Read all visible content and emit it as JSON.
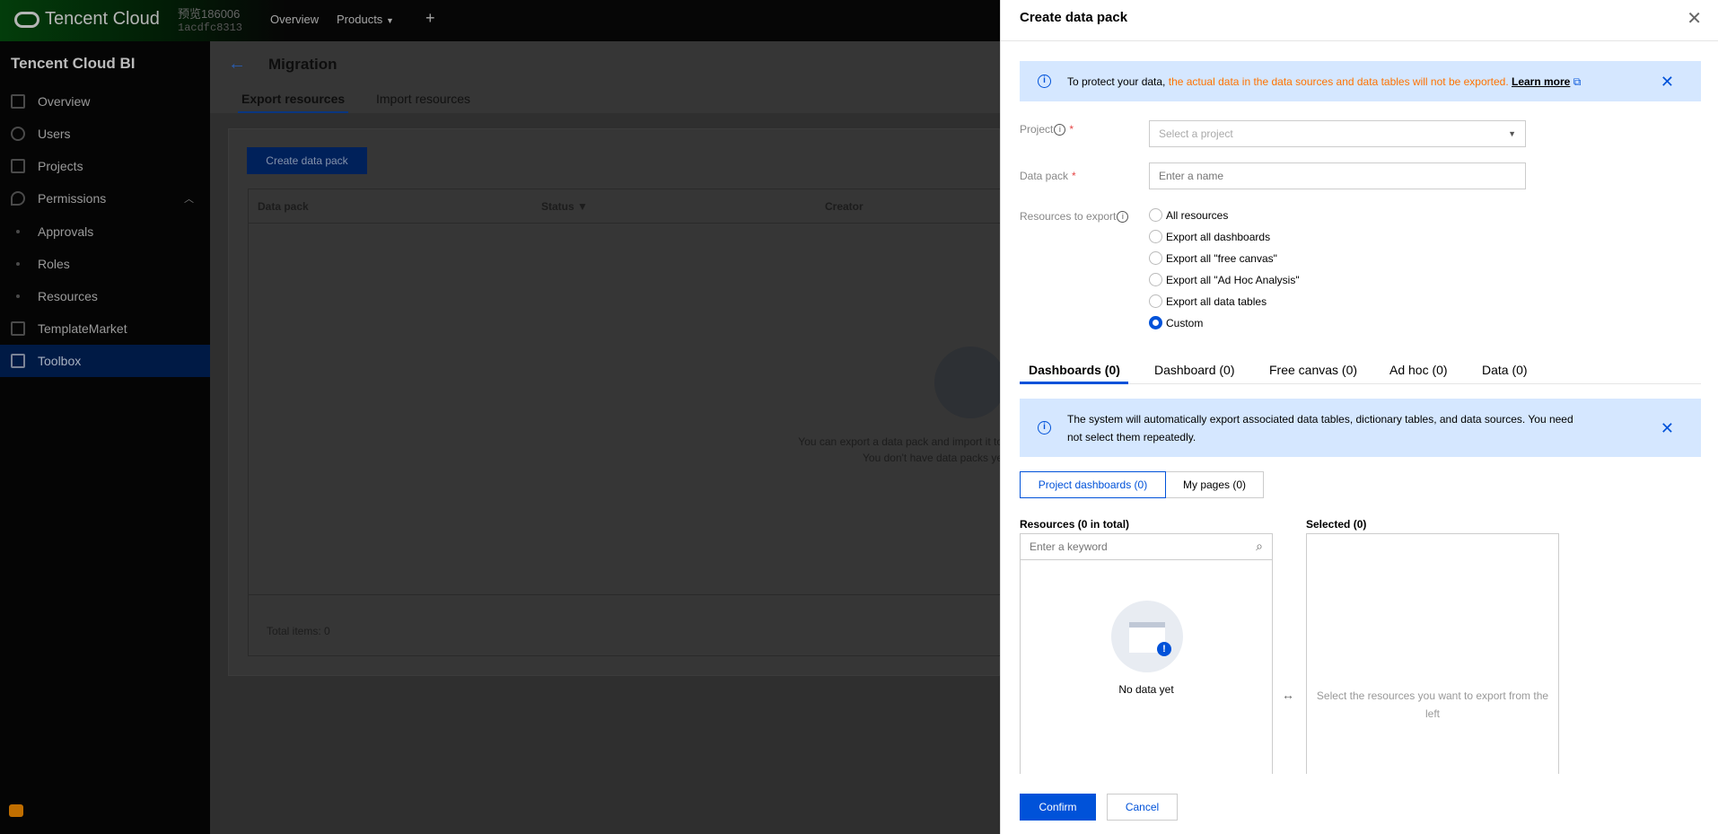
{
  "topbar": {
    "brand": "Tencent Cloud",
    "account_name": "预览186006",
    "account_id": "1acdfc8313",
    "nav": [
      "Overview",
      "Products"
    ],
    "plus": "+"
  },
  "sidebar": {
    "title": "Tencent Cloud BI",
    "items": [
      {
        "label": "Overview",
        "icon": "grid-icon"
      },
      {
        "label": "Users",
        "icon": "user-icon"
      },
      {
        "label": "Projects",
        "icon": "project-icon"
      },
      {
        "label": "Permissions",
        "icon": "key-icon"
      },
      {
        "label": "Approvals"
      },
      {
        "label": "Roles"
      },
      {
        "label": "Resources"
      },
      {
        "label": "TemplateMarket",
        "icon": "template-icon"
      },
      {
        "label": "Toolbox",
        "icon": "toolbox-icon",
        "active": true
      }
    ]
  },
  "main": {
    "title": "Migration",
    "tabs": [
      "Export resources",
      "Import resources"
    ],
    "create_button": "Create data pack",
    "columns": [
      "Data pack",
      "Status",
      "Creator"
    ],
    "empty_line1": "You can export a data pack and import it to",
    "empty_line2": "You don't have data packs ye",
    "total": "Total items:  0"
  },
  "drawer": {
    "title": "Create data pack",
    "alert1": {
      "prefix": "To protect your data, ",
      "highlight": "the actual data in the data sources and data tables will not be exported.",
      "link": "Learn more"
    },
    "project_label": "Project",
    "project_placeholder": "Select a project",
    "datapack_label": "Data pack",
    "datapack_placeholder": "Enter a name",
    "resources_label": "Resources to export",
    "radios": [
      "All resources",
      "Export all dashboards",
      "Export all \"free canvas\"",
      "Export all \"Ad Hoc Analysis\"",
      "Export all data tables",
      "Custom"
    ],
    "selected_radio": "Custom",
    "tabs": [
      "Dashboards (0)",
      "Dashboard (0)",
      "Free canvas (0)",
      "Ad hoc (0)",
      "Data (0)"
    ],
    "alert2": "The system will automatically export associated data tables, dictionary tables, and data sources. You need not select them repeatedly.",
    "segments": [
      "Project dashboards (0)",
      "My pages (0)"
    ],
    "resources_title": "Resources (0 in total)",
    "search_placeholder": "Enter a keyword",
    "no_data": "No data yet",
    "selected_title": "Selected (0)",
    "selected_hint": "Select the resources you want to export from the left",
    "confirm": "Confirm",
    "cancel": "Cancel"
  },
  "colors": {
    "primary": "#0052d9",
    "warning": "#ff7200",
    "alert_bg": "#d5e7ff"
  }
}
